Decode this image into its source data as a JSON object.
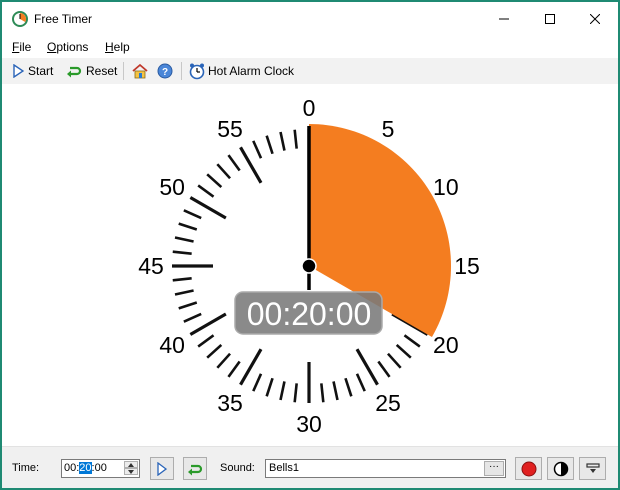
{
  "window": {
    "title": "Free Timer"
  },
  "menu": {
    "file_prefix": "F",
    "file_rest": "ile",
    "options_prefix": "O",
    "options_rest": "ptions",
    "help_prefix": "H",
    "help_rest": "elp"
  },
  "toolbar": {
    "start_label": "Start",
    "reset_label": "Reset",
    "hot_alarm_label": "Hot Alarm Clock"
  },
  "dial": {
    "set_minutes": 20,
    "max_minutes": 60,
    "elapsed_hand_minutes": 0,
    "display_time": "00:20:00",
    "minute_labels": [
      "0",
      "5",
      "10",
      "15",
      "20",
      "25",
      "30",
      "35",
      "40",
      "45",
      "50",
      "55"
    ],
    "fill_color": "#f47d20"
  },
  "bottom": {
    "time_label": "Time:",
    "time_hh": "00:",
    "time_mm": "20",
    "time_ss": ":00",
    "sound_label": "Sound:",
    "sound_value": "Bells1",
    "browse_label": "···"
  },
  "icons": {
    "app": "clock-icon",
    "start": "play-triangle-icon",
    "reset": "reset-arrow-icon",
    "home": "home-icon",
    "help": "help-icon",
    "alarm": "alarm-clock-icon",
    "record": "red-circle-icon",
    "theme": "contrast-icon",
    "minimize-to-tray": "tray-icon"
  }
}
